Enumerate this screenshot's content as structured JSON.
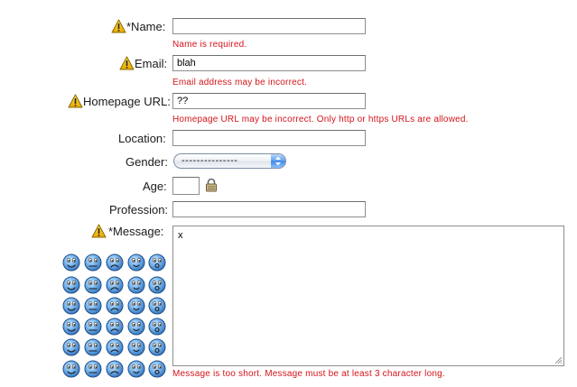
{
  "fields": {
    "name": {
      "label": "*Name:",
      "value": "",
      "error": "Name is required."
    },
    "email": {
      "label": "Email:",
      "value": "blah",
      "error": "Email address may be incorrect."
    },
    "homepage": {
      "label": "Homepage URL:",
      "value": "??",
      "error": "Homepage URL may be incorrect. Only http or https URLs are allowed."
    },
    "location": {
      "label": "Location:",
      "value": ""
    },
    "gender": {
      "label": "Gender:",
      "selected": "---------------"
    },
    "age": {
      "label": "Age:",
      "value": ""
    },
    "profession": {
      "label": "Profession:",
      "value": ""
    },
    "message": {
      "label": "*Message:",
      "value": "x",
      "error": "Message is too short. Message must be at least 3 character long."
    }
  },
  "icons": {
    "warning": "warning-icon",
    "lock": "lock-icon",
    "smileys": [
      "smiley-icon"
    ]
  },
  "colors": {
    "error": "#d4141b",
    "warning": "#f2b800",
    "smiley": "#5aa3e8",
    "select_accent": "#3b87ea"
  }
}
